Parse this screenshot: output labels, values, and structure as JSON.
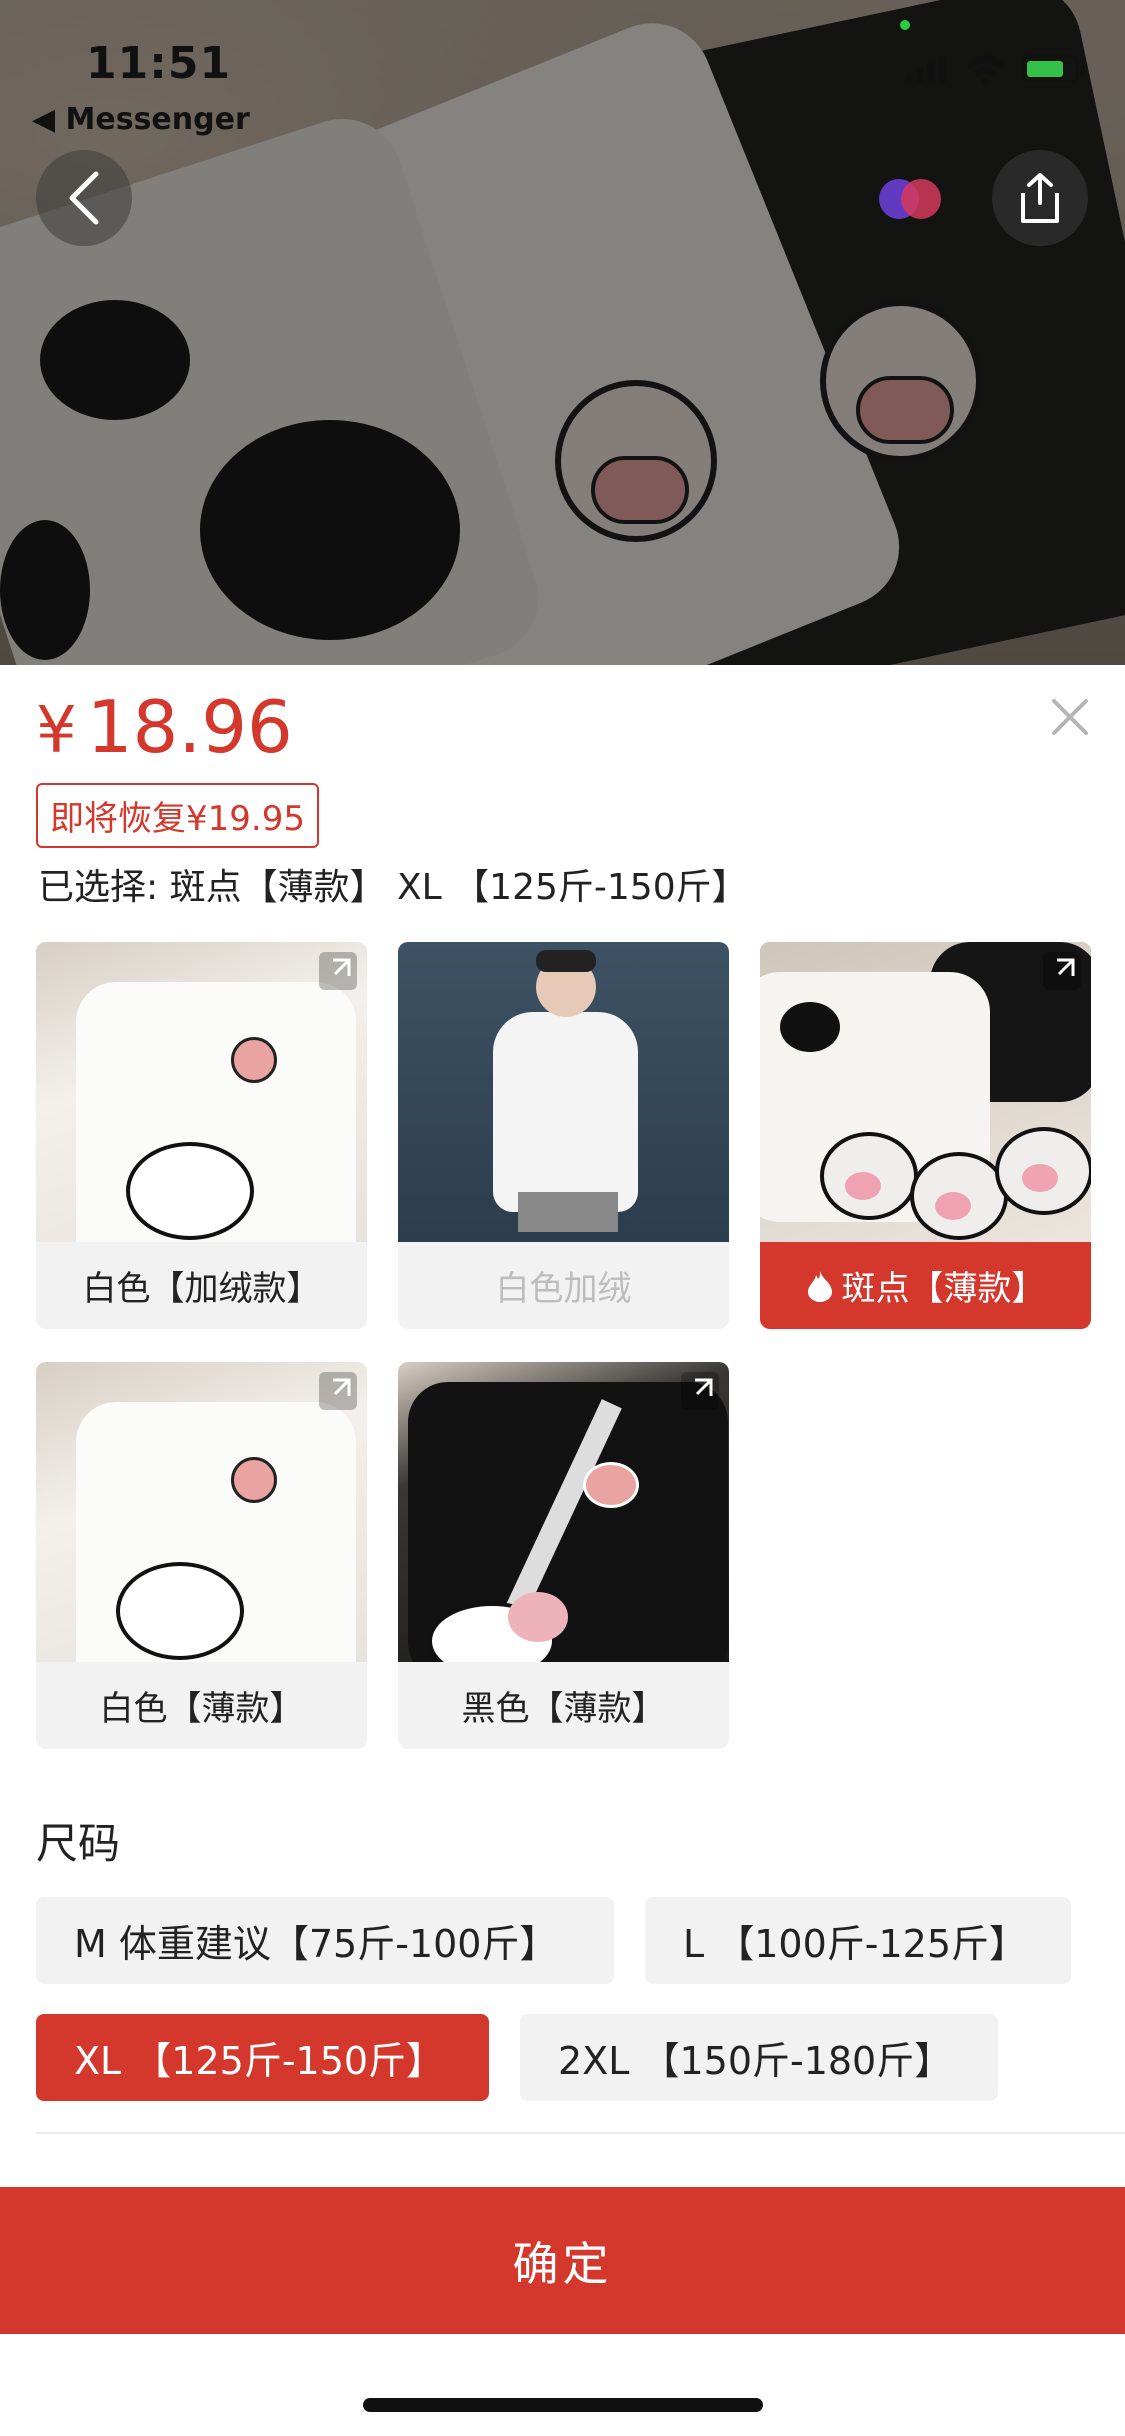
{
  "status_bar": {
    "time": "11:51",
    "back_app": "◀ Messenger"
  },
  "product": {
    "currency": "¥",
    "price": "18.96",
    "restore_note": "即将恢复¥19.95",
    "selected_text": "已选择: 斑点【薄款】 XL 【125斤-150斤】"
  },
  "variants": [
    {
      "label": "白色【加绒款】",
      "state": "normal"
    },
    {
      "label": "白色加绒",
      "state": "disabled"
    },
    {
      "label": "斑点【薄款】",
      "state": "active"
    },
    {
      "label": "白色【薄款】",
      "state": "normal"
    },
    {
      "label": "黑色【薄款】",
      "state": "normal"
    }
  ],
  "size": {
    "title": "尺码",
    "options": [
      {
        "label": "M 体重建议【75斤-100斤】",
        "state": "normal"
      },
      {
        "label": "L 【100斤-125斤】",
        "state": "normal"
      },
      {
        "label": "XL 【125斤-150斤】",
        "state": "active"
      },
      {
        "label": "2XL 【150斤-180斤】",
        "state": "normal"
      }
    ]
  },
  "confirm_button": "确定",
  "colors": {
    "accent": "#d4372c",
    "chip_bg": "#f2f2f2",
    "disabled_text": "#bdbdbd"
  }
}
